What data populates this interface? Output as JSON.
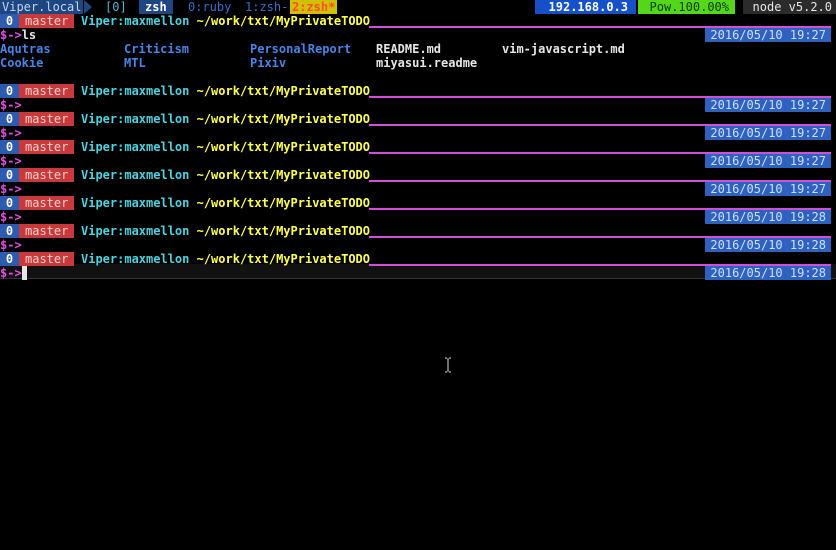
{
  "tmux": {
    "hostname": "Viper.local",
    "window_index": "[0]",
    "session": "zsh",
    "windows": [
      "0:ruby",
      "1:zsh-",
      "2:zsh*"
    ],
    "ip": "192.168.0.3",
    "power": "Pow.100.00%",
    "node": "node v5.2.0"
  },
  "prompt": {
    "badge": "0",
    "branch": "master",
    "user": "Viper:maxmellon",
    "path": " ~/work/txt/MyPrivateTODO",
    "ps2": "$->"
  },
  "first_command": "ls",
  "ls_output": {
    "rows": [
      [
        {
          "name": "Aqutras",
          "type": "dir"
        },
        {
          "name": "Criticism",
          "type": "dir"
        },
        {
          "name": "PersonalReport",
          "type": "dir"
        },
        {
          "name": "README.md",
          "type": "file"
        },
        {
          "name": "vim-javascript.md",
          "type": "file"
        }
      ],
      [
        {
          "name": "Cookie",
          "type": "dir"
        },
        {
          "name": "MTL",
          "type": "dir"
        },
        {
          "name": "Pixiv",
          "type": "dir"
        },
        {
          "name": "miyasui.readme",
          "type": "file"
        }
      ]
    ]
  },
  "timestamps": [
    "2016/05/10 19:27",
    "2016/05/10 19:27",
    "2016/05/10 19:27",
    "2016/05/10 19:27",
    "2016/05/10 19:27",
    "2016/05/10 19:28",
    "2016/05/10 19:28",
    "2016/05/10 19:28"
  ],
  "colors": {
    "status_blue": "#1e4680",
    "branch_red": "#c83a3a",
    "path_yellow": "#ffff55",
    "user_cyan": "#4fd3e0",
    "prompt_magenta": "#e64fe8",
    "dir_blue": "#4a84e8",
    "pow_green": "#54d61a"
  }
}
